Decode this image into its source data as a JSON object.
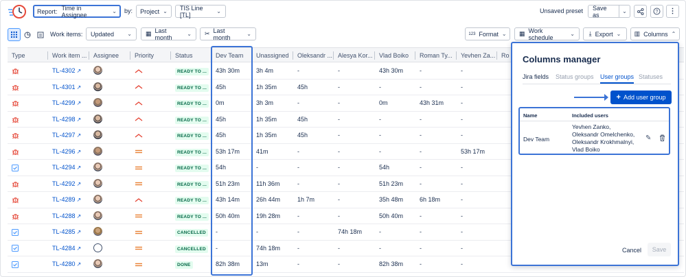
{
  "header": {
    "report_label": "Report:",
    "report_value": "Time in Assignee",
    "by_label": "by:",
    "group_by": "Project",
    "project": "TIS Line [TL]",
    "unsaved": "Unsaved preset",
    "save_as": "Save as"
  },
  "toolbar": {
    "work_items_label": "Work items:",
    "work_items_value": "Updated",
    "date_filter_1": "Last month",
    "date_filter_2": "Last month",
    "format": "Format",
    "format_prefix": "123",
    "work_schedule": "Work schedule",
    "export": "Export",
    "columns": "Columns"
  },
  "table": {
    "columns": [
      "Type",
      "Work item ...",
      "Assignee",
      "Priority",
      "Status",
      "Dev Team",
      "Unassigned",
      "Oleksandr ...",
      "Alesya Kor...",
      "Vlad Boiko",
      "Roman Ty...",
      "Yevhen Za...",
      "Ro"
    ],
    "rows": [
      {
        "type": "bug",
        "key": "TL-4302",
        "avatar": "a",
        "priority": "high",
        "status": "READY TO ...",
        "status_kind": "ready",
        "dev": "43h 30m",
        "unassigned": "3h 4m",
        "oleksandr": "-",
        "alesya": "-",
        "vlad": "43h 30m",
        "roman": "-",
        "yevhen": "-"
      },
      {
        "type": "bug",
        "key": "TL-4301",
        "avatar": "b",
        "priority": "high",
        "status": "READY TO ...",
        "status_kind": "ready",
        "dev": "45h",
        "unassigned": "1h 35m",
        "oleksandr": "45h",
        "alesya": "-",
        "vlad": "-",
        "roman": "-",
        "yevhen": "-"
      },
      {
        "type": "bug",
        "key": "TL-4299",
        "avatar": "c",
        "priority": "high",
        "status": "READY TO ...",
        "status_kind": "ready",
        "dev": "0m",
        "unassigned": "3h 3m",
        "oleksandr": "-",
        "alesya": "-",
        "vlad": "0m",
        "roman": "43h 31m",
        "yevhen": "-"
      },
      {
        "type": "bug",
        "key": "TL-4298",
        "avatar": "b",
        "priority": "high",
        "status": "READY TO ...",
        "status_kind": "ready",
        "dev": "45h",
        "unassigned": "1h 35m",
        "oleksandr": "45h",
        "alesya": "-",
        "vlad": "-",
        "roman": "-",
        "yevhen": "-"
      },
      {
        "type": "bug",
        "key": "TL-4297",
        "avatar": "b",
        "priority": "high",
        "status": "READY TO ...",
        "status_kind": "ready",
        "dev": "45h",
        "unassigned": "1h 35m",
        "oleksandr": "45h",
        "alesya": "-",
        "vlad": "-",
        "roman": "-",
        "yevhen": "-"
      },
      {
        "type": "bug",
        "key": "TL-4296",
        "avatar": "c",
        "priority": "medium",
        "status": "READY TO ...",
        "status_kind": "ready",
        "dev": "53h 17m",
        "unassigned": "41m",
        "oleksandr": "-",
        "alesya": "-",
        "vlad": "-",
        "roman": "-",
        "yevhen": "53h 17m"
      },
      {
        "type": "task",
        "key": "TL-4294",
        "avatar": "a",
        "priority": "medium",
        "status": "READY TO ...",
        "status_kind": "ready",
        "dev": "54h",
        "unassigned": "-",
        "oleksandr": "-",
        "alesya": "-",
        "vlad": "54h",
        "roman": "-",
        "yevhen": "-"
      },
      {
        "type": "bug",
        "key": "TL-4292",
        "avatar": "a",
        "priority": "medium",
        "status": "READY TO ...",
        "status_kind": "ready",
        "dev": "51h 23m",
        "unassigned": "11h 36m",
        "oleksandr": "-",
        "alesya": "-",
        "vlad": "51h 23m",
        "roman": "-",
        "yevhen": "-"
      },
      {
        "type": "bug",
        "key": "TL-4289",
        "avatar": "a",
        "priority": "high",
        "status": "READY TO ...",
        "status_kind": "ready",
        "dev": "43h 14m",
        "unassigned": "26h 44m",
        "oleksandr": "1h 7m",
        "alesya": "-",
        "vlad": "35h 48m",
        "roman": "6h 18m",
        "yevhen": "-"
      },
      {
        "type": "bug",
        "key": "TL-4288",
        "avatar": "a",
        "priority": "medium",
        "status": "READY TO ...",
        "status_kind": "ready",
        "dev": "50h 40m",
        "unassigned": "19h 28m",
        "oleksandr": "-",
        "alesya": "-",
        "vlad": "50h 40m",
        "roman": "-",
        "yevhen": "-"
      },
      {
        "type": "task",
        "key": "TL-4285",
        "avatar": "d",
        "priority": "medium",
        "status": "CANCELLED",
        "status_kind": "cancel",
        "dev": "-",
        "unassigned": "-",
        "oleksandr": "-",
        "alesya": "74h 18m",
        "vlad": "-",
        "roman": "-",
        "yevhen": "-"
      },
      {
        "type": "task",
        "key": "TL-4284",
        "avatar": "e",
        "priority": "medium",
        "status": "CANCELLED",
        "status_kind": "cancel",
        "dev": "-",
        "unassigned": "74h 18m",
        "oleksandr": "-",
        "alesya": "-",
        "vlad": "-",
        "roman": "-",
        "yevhen": "-"
      },
      {
        "type": "task",
        "key": "TL-4280",
        "avatar": "a",
        "priority": "medium",
        "status": "DONE",
        "status_kind": "done",
        "dev": "82h 38m",
        "unassigned": "13m",
        "oleksandr": "-",
        "alesya": "-",
        "vlad": "82h 38m",
        "roman": "-",
        "yevhen": "-"
      }
    ]
  },
  "columns_manager": {
    "title": "Columns manager",
    "tabs": [
      "Jira fields",
      "Status groups",
      "User groups",
      "Statuses"
    ],
    "active_tab": "User groups",
    "add_button": "Add user group",
    "col_name": "Name",
    "col_users": "Included users",
    "groups": [
      {
        "name": "Dev Team",
        "users": [
          "Yevhen Zanko,",
          "Oleksandr Omelchenko,",
          "Oleksandr Krokhmalnyi,",
          "Vlad Boiko"
        ]
      }
    ],
    "cancel": "Cancel",
    "save": "Save"
  },
  "colors": {
    "accent": "#0052cc",
    "highlight": "#3b73d6",
    "bug": "#e5493a",
    "high_priority": "#e5493a",
    "medium_priority": "#e97f33",
    "task": "#4c9aff"
  }
}
